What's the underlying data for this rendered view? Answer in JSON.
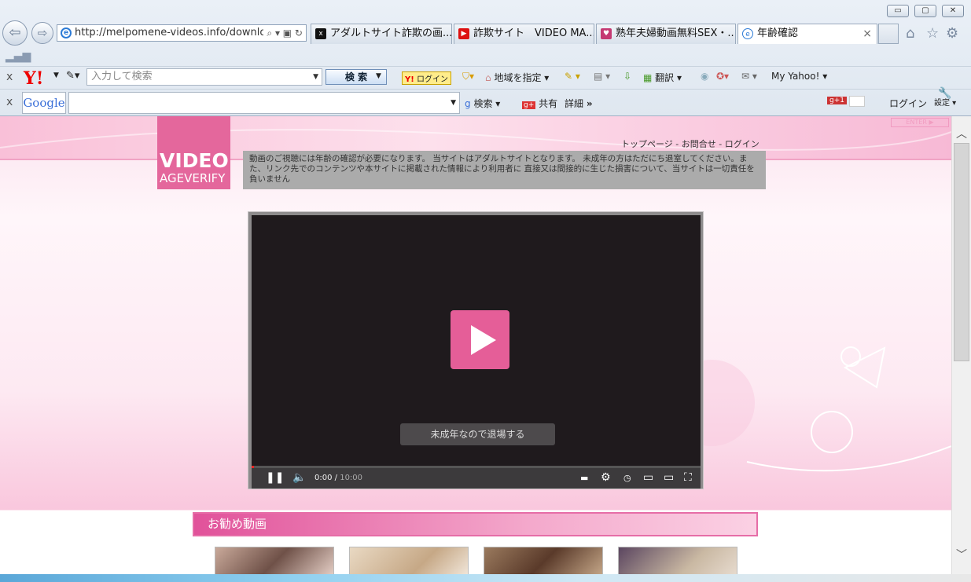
{
  "browser": {
    "address": "http://melpomene-videos.info/downloa",
    "tabs": [
      {
        "label": "アダルトサイト詐欺の画...",
        "icon": "x-icon"
      },
      {
        "label": "詐欺サイト　VIDEO MA...",
        "icon": "youtube-icon"
      },
      {
        "label": "熟年夫婦動画無料SEX・...",
        "icon": "site-icon"
      },
      {
        "label": "年齢確認",
        "icon": "ie-icon"
      }
    ],
    "window_controls": [
      "minimize",
      "maximize",
      "close"
    ]
  },
  "yahoo_toolbar": {
    "search_placeholder": "入力して検索",
    "search_button": "検 索",
    "login": "ログイン",
    "region": "地域を指定",
    "translate": "翻訳",
    "my_yahoo": "My Yahoo!"
  },
  "google_toolbar": {
    "logo": "Google",
    "search": "検索",
    "share": "共有",
    "details": "詳細",
    "login": "ログイン",
    "settings": "設定"
  },
  "page": {
    "logo_line1": "VIDEO",
    "logo_line2": "AGEVERIFY",
    "top_links": "トップページ - お問合せ - ログイン",
    "enter": "ENTER",
    "notice": "動画のご視聴には年齢の確認が必要になります。 当サイトはアダルトサイトとなります。 未成年の方はただにち退室してください。また、リンク先でのコンテンツや本サイトに掲載された情報により利用者に 直接又は間接的に生じた損害について、当サイトは一切責任を負いません",
    "exit_button": "未成年なので退場する",
    "time_current": "0:00",
    "time_total": "10:00",
    "recommend_title": "お勧め動画",
    "thumb_count": 4
  },
  "colors": {
    "accent_pink": "#e4679c",
    "play_pink": "#e55e98",
    "player_bg": "#1f1a1d"
  }
}
